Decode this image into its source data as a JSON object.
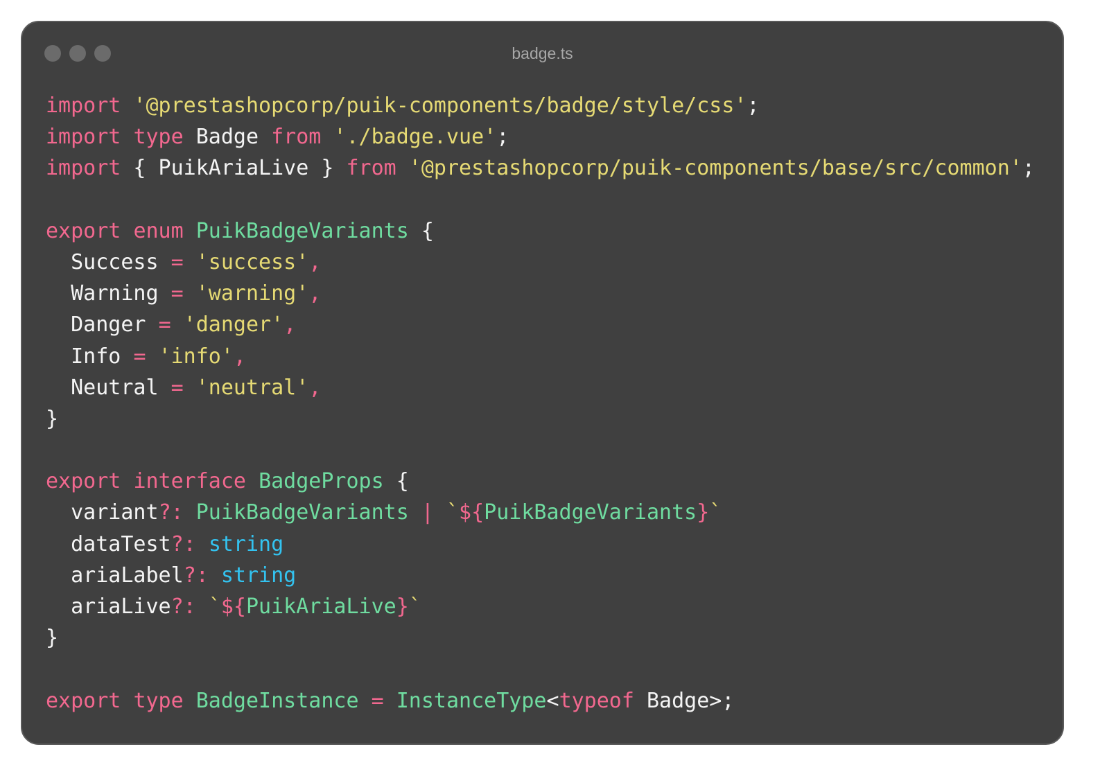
{
  "window": {
    "title": "badge.ts",
    "controls": [
      "close-dot",
      "minimize-dot",
      "zoom-dot"
    ]
  },
  "colors": {
    "background": "#404040",
    "keyword": "#f2688f",
    "string": "#e6da74",
    "type": "#6fdca0",
    "primitive": "#33c3f0",
    "identifier": "#f4f4f4"
  },
  "code": {
    "language": "typescript",
    "lines": [
      [
        [
          "kw",
          "import"
        ],
        [
          "id",
          " "
        ],
        [
          "str",
          "'@prestashopcorp/puik-components/badge/style/css'"
        ],
        [
          "id",
          ";"
        ]
      ],
      [
        [
          "kw",
          "import"
        ],
        [
          "id",
          " "
        ],
        [
          "kw",
          "type"
        ],
        [
          "id",
          " Badge "
        ],
        [
          "kw",
          "from"
        ],
        [
          "id",
          " "
        ],
        [
          "str",
          "'./badge.vue'"
        ],
        [
          "id",
          ";"
        ]
      ],
      [
        [
          "kw",
          "import"
        ],
        [
          "id",
          " { PuikAriaLive } "
        ],
        [
          "kw",
          "from"
        ],
        [
          "id",
          " "
        ],
        [
          "str",
          "'@prestashopcorp/puik-components/base/src/common'"
        ],
        [
          "id",
          ";"
        ]
      ],
      [],
      [
        [
          "kw",
          "export"
        ],
        [
          "id",
          " "
        ],
        [
          "kw",
          "enum"
        ],
        [
          "id",
          " "
        ],
        [
          "type",
          "PuikBadgeVariants"
        ],
        [
          "id",
          " {"
        ]
      ],
      [
        [
          "id",
          "  Success "
        ],
        [
          "pun",
          "="
        ],
        [
          "id",
          " "
        ],
        [
          "str",
          "'success'"
        ],
        [
          "pun",
          ","
        ]
      ],
      [
        [
          "id",
          "  Warning "
        ],
        [
          "pun",
          "="
        ],
        [
          "id",
          " "
        ],
        [
          "str",
          "'warning'"
        ],
        [
          "pun",
          ","
        ]
      ],
      [
        [
          "id",
          "  Danger "
        ],
        [
          "pun",
          "="
        ],
        [
          "id",
          " "
        ],
        [
          "str",
          "'danger'"
        ],
        [
          "pun",
          ","
        ]
      ],
      [
        [
          "id",
          "  Info "
        ],
        [
          "pun",
          "="
        ],
        [
          "id",
          " "
        ],
        [
          "str",
          "'info'"
        ],
        [
          "pun",
          ","
        ]
      ],
      [
        [
          "id",
          "  Neutral "
        ],
        [
          "pun",
          "="
        ],
        [
          "id",
          " "
        ],
        [
          "str",
          "'neutral'"
        ],
        [
          "pun",
          ","
        ]
      ],
      [
        [
          "id",
          "}"
        ]
      ],
      [],
      [
        [
          "kw",
          "export"
        ],
        [
          "id",
          " "
        ],
        [
          "kw",
          "interface"
        ],
        [
          "id",
          " "
        ],
        [
          "type",
          "BadgeProps"
        ],
        [
          "id",
          " {"
        ]
      ],
      [
        [
          "id",
          "  variant"
        ],
        [
          "pun",
          "?:"
        ],
        [
          "id",
          " "
        ],
        [
          "type",
          "PuikBadgeVariants"
        ],
        [
          "id",
          " "
        ],
        [
          "pun",
          "|"
        ],
        [
          "id",
          " "
        ],
        [
          "str",
          "`"
        ],
        [
          "pun",
          "${"
        ],
        [
          "type",
          "PuikBadgeVariants"
        ],
        [
          "pun",
          "}"
        ],
        [
          "str",
          "`"
        ]
      ],
      [
        [
          "id",
          "  dataTest"
        ],
        [
          "pun",
          "?:"
        ],
        [
          "id",
          " "
        ],
        [
          "prim",
          "string"
        ]
      ],
      [
        [
          "id",
          "  ariaLabel"
        ],
        [
          "pun",
          "?:"
        ],
        [
          "id",
          " "
        ],
        [
          "prim",
          "string"
        ]
      ],
      [
        [
          "id",
          "  ariaLive"
        ],
        [
          "pun",
          "?:"
        ],
        [
          "id",
          " "
        ],
        [
          "str",
          "`"
        ],
        [
          "pun",
          "${"
        ],
        [
          "type",
          "PuikAriaLive"
        ],
        [
          "pun",
          "}"
        ],
        [
          "str",
          "`"
        ]
      ],
      [
        [
          "id",
          "}"
        ]
      ],
      [],
      [
        [
          "kw",
          "export"
        ],
        [
          "id",
          " "
        ],
        [
          "kw",
          "type"
        ],
        [
          "id",
          " "
        ],
        [
          "type",
          "BadgeInstance"
        ],
        [
          "id",
          " "
        ],
        [
          "pun",
          "="
        ],
        [
          "id",
          " "
        ],
        [
          "type",
          "InstanceType"
        ],
        [
          "id",
          "<"
        ],
        [
          "kw",
          "typeof"
        ],
        [
          "id",
          " Badge>;"
        ]
      ]
    ]
  }
}
